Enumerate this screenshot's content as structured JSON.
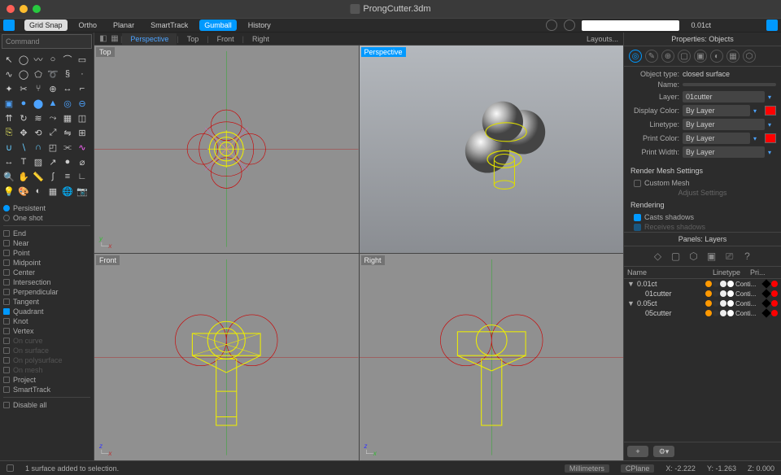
{
  "title": "ProngCutter.3dm",
  "top_toolbar": {
    "grid_snap": "Grid Snap",
    "ortho": "Ortho",
    "planar": "Planar",
    "smarttrack": "SmartTrack",
    "gumball": "Gumball",
    "history": "History",
    "carat": "0.01ct"
  },
  "viewport_tabs": {
    "perspective": "Perspective",
    "top": "Top",
    "front": "Front",
    "right": "Right",
    "layouts": "Layouts..."
  },
  "command_prompt": "Command",
  "osnaps": {
    "persistent": "Persistent",
    "one_shot": "One shot",
    "end": "End",
    "near": "Near",
    "point": "Point",
    "midpoint": "Midpoint",
    "center": "Center",
    "intersection": "Intersection",
    "perpendicular": "Perpendicular",
    "tangent": "Tangent",
    "quadrant": "Quadrant",
    "knot": "Knot",
    "vertex": "Vertex",
    "on_curve": "On curve",
    "on_surface": "On surface",
    "on_polysurface": "On polysurface",
    "on_mesh": "On mesh",
    "project": "Project",
    "smarttrack": "SmartTrack",
    "disable_all": "Disable all"
  },
  "viewports": {
    "top": "Top",
    "perspective": "Perspective",
    "front": "Front",
    "right": "Right"
  },
  "properties": {
    "header": "Properties: Objects",
    "object_type_lbl": "Object type:",
    "object_type_val": "closed surface",
    "name_lbl": "Name:",
    "name_val": "",
    "layer_lbl": "Layer:",
    "layer_val": "01cutter",
    "display_color_lbl": "Display Color:",
    "display_color_val": "By Layer",
    "linetype_lbl": "Linetype:",
    "linetype_val": "By Layer",
    "print_color_lbl": "Print Color:",
    "print_color_val": "By Layer",
    "print_width_lbl": "Print Width:",
    "print_width_val": "By Layer",
    "render_mesh_hdr": "Render Mesh Settings",
    "custom_mesh": "Custom Mesh",
    "adjust_settings": "Adjust Settings",
    "rendering_hdr": "Rendering",
    "casts_shadows": "Casts shadows",
    "receives_shadows": "Receives shadows"
  },
  "layers": {
    "panel_hdr": "Panels: Layers",
    "col_name": "Name",
    "col_linetype": "Linetype",
    "col_pri": "Pri...",
    "rows": [
      {
        "name": "0.01ct",
        "lt": "Conti...",
        "indent": 0,
        "arrow": "▼"
      },
      {
        "name": "01cutter",
        "lt": "Conti...",
        "indent": 1,
        "arrow": ""
      },
      {
        "name": "0.05ct",
        "lt": "Conti...",
        "indent": 0,
        "arrow": "▼"
      },
      {
        "name": "05cutter",
        "lt": "Conti...",
        "indent": 1,
        "arrow": ""
      }
    ]
  },
  "status": {
    "msg": "1 surface added to selection.",
    "units": "Millimeters",
    "cplane": "CPlane",
    "x": "X: -2.222",
    "y": "Y: -1.263",
    "z": "Z: 0.000"
  }
}
